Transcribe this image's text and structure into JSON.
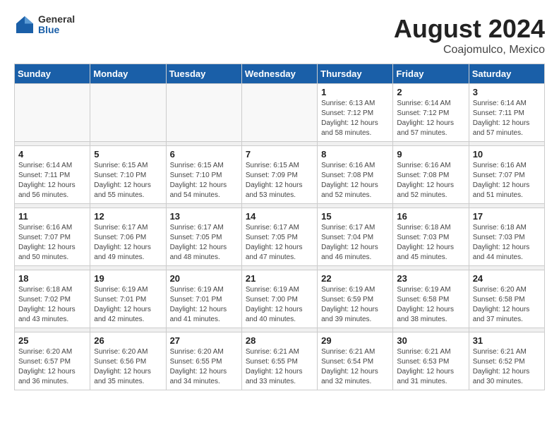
{
  "header": {
    "logo_general": "General",
    "logo_blue": "Blue",
    "month_year": "August 2024",
    "location": "Coajomulco, Mexico"
  },
  "days_of_week": [
    "Sunday",
    "Monday",
    "Tuesday",
    "Wednesday",
    "Thursday",
    "Friday",
    "Saturday"
  ],
  "weeks": [
    [
      {
        "day": "",
        "info": ""
      },
      {
        "day": "",
        "info": ""
      },
      {
        "day": "",
        "info": ""
      },
      {
        "day": "",
        "info": ""
      },
      {
        "day": "1",
        "info": "Sunrise: 6:13 AM\nSunset: 7:12 PM\nDaylight: 12 hours\nand 58 minutes."
      },
      {
        "day": "2",
        "info": "Sunrise: 6:14 AM\nSunset: 7:12 PM\nDaylight: 12 hours\nand 57 minutes."
      },
      {
        "day": "3",
        "info": "Sunrise: 6:14 AM\nSunset: 7:11 PM\nDaylight: 12 hours\nand 57 minutes."
      }
    ],
    [
      {
        "day": "4",
        "info": "Sunrise: 6:14 AM\nSunset: 7:11 PM\nDaylight: 12 hours\nand 56 minutes."
      },
      {
        "day": "5",
        "info": "Sunrise: 6:15 AM\nSunset: 7:10 PM\nDaylight: 12 hours\nand 55 minutes."
      },
      {
        "day": "6",
        "info": "Sunrise: 6:15 AM\nSunset: 7:10 PM\nDaylight: 12 hours\nand 54 minutes."
      },
      {
        "day": "7",
        "info": "Sunrise: 6:15 AM\nSunset: 7:09 PM\nDaylight: 12 hours\nand 53 minutes."
      },
      {
        "day": "8",
        "info": "Sunrise: 6:16 AM\nSunset: 7:08 PM\nDaylight: 12 hours\nand 52 minutes."
      },
      {
        "day": "9",
        "info": "Sunrise: 6:16 AM\nSunset: 7:08 PM\nDaylight: 12 hours\nand 52 minutes."
      },
      {
        "day": "10",
        "info": "Sunrise: 6:16 AM\nSunset: 7:07 PM\nDaylight: 12 hours\nand 51 minutes."
      }
    ],
    [
      {
        "day": "11",
        "info": "Sunrise: 6:16 AM\nSunset: 7:07 PM\nDaylight: 12 hours\nand 50 minutes."
      },
      {
        "day": "12",
        "info": "Sunrise: 6:17 AM\nSunset: 7:06 PM\nDaylight: 12 hours\nand 49 minutes."
      },
      {
        "day": "13",
        "info": "Sunrise: 6:17 AM\nSunset: 7:05 PM\nDaylight: 12 hours\nand 48 minutes."
      },
      {
        "day": "14",
        "info": "Sunrise: 6:17 AM\nSunset: 7:05 PM\nDaylight: 12 hours\nand 47 minutes."
      },
      {
        "day": "15",
        "info": "Sunrise: 6:17 AM\nSunset: 7:04 PM\nDaylight: 12 hours\nand 46 minutes."
      },
      {
        "day": "16",
        "info": "Sunrise: 6:18 AM\nSunset: 7:03 PM\nDaylight: 12 hours\nand 45 minutes."
      },
      {
        "day": "17",
        "info": "Sunrise: 6:18 AM\nSunset: 7:03 PM\nDaylight: 12 hours\nand 44 minutes."
      }
    ],
    [
      {
        "day": "18",
        "info": "Sunrise: 6:18 AM\nSunset: 7:02 PM\nDaylight: 12 hours\nand 43 minutes."
      },
      {
        "day": "19",
        "info": "Sunrise: 6:19 AM\nSunset: 7:01 PM\nDaylight: 12 hours\nand 42 minutes."
      },
      {
        "day": "20",
        "info": "Sunrise: 6:19 AM\nSunset: 7:01 PM\nDaylight: 12 hours\nand 41 minutes."
      },
      {
        "day": "21",
        "info": "Sunrise: 6:19 AM\nSunset: 7:00 PM\nDaylight: 12 hours\nand 40 minutes."
      },
      {
        "day": "22",
        "info": "Sunrise: 6:19 AM\nSunset: 6:59 PM\nDaylight: 12 hours\nand 39 minutes."
      },
      {
        "day": "23",
        "info": "Sunrise: 6:19 AM\nSunset: 6:58 PM\nDaylight: 12 hours\nand 38 minutes."
      },
      {
        "day": "24",
        "info": "Sunrise: 6:20 AM\nSunset: 6:58 PM\nDaylight: 12 hours\nand 37 minutes."
      }
    ],
    [
      {
        "day": "25",
        "info": "Sunrise: 6:20 AM\nSunset: 6:57 PM\nDaylight: 12 hours\nand 36 minutes."
      },
      {
        "day": "26",
        "info": "Sunrise: 6:20 AM\nSunset: 6:56 PM\nDaylight: 12 hours\nand 35 minutes."
      },
      {
        "day": "27",
        "info": "Sunrise: 6:20 AM\nSunset: 6:55 PM\nDaylight: 12 hours\nand 34 minutes."
      },
      {
        "day": "28",
        "info": "Sunrise: 6:21 AM\nSunset: 6:55 PM\nDaylight: 12 hours\nand 33 minutes."
      },
      {
        "day": "29",
        "info": "Sunrise: 6:21 AM\nSunset: 6:54 PM\nDaylight: 12 hours\nand 32 minutes."
      },
      {
        "day": "30",
        "info": "Sunrise: 6:21 AM\nSunset: 6:53 PM\nDaylight: 12 hours\nand 31 minutes."
      },
      {
        "day": "31",
        "info": "Sunrise: 6:21 AM\nSunset: 6:52 PM\nDaylight: 12 hours\nand 30 minutes."
      }
    ]
  ]
}
